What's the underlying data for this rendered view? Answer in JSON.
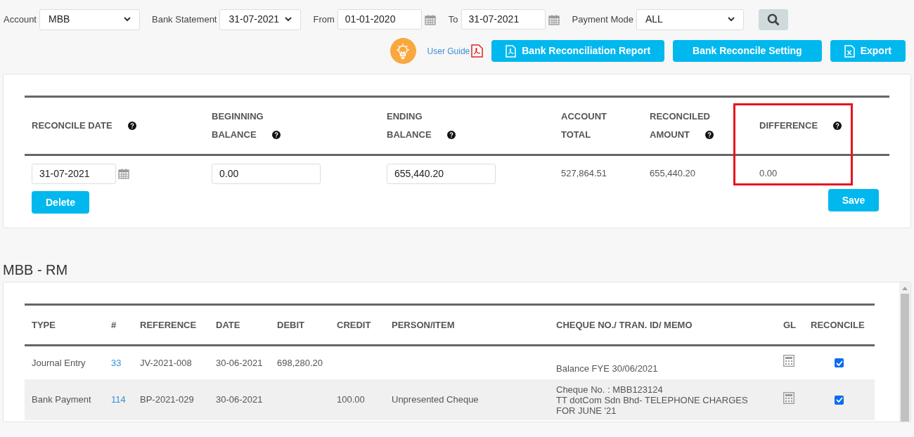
{
  "filters": [
    {
      "kind": "select",
      "label": "Account",
      "value": "MBB"
    },
    {
      "kind": "select",
      "label": "Bank Statement",
      "value": "31-07-2021"
    },
    {
      "kind": "date",
      "label": "From",
      "value": "01-01-2020"
    },
    {
      "kind": "date",
      "label": "To",
      "value": "31-07-2021"
    },
    {
      "kind": "select",
      "label": "Payment Mode",
      "value": "ALL"
    }
  ],
  "user_guide": "User Guide",
  "actions": [
    {
      "kind": "pdf",
      "label": "Bank Reconciliation Report"
    },
    {
      "kind": "plain",
      "label": "Bank Reconcile Setting"
    },
    {
      "kind": "excel",
      "label": "Export"
    }
  ],
  "summary": {
    "columns": [
      {
        "lines": [
          "RECONCILE DATE"
        ],
        "help": true,
        "highlighted": false
      },
      {
        "lines": [
          "BEGINNING",
          "BALANCE"
        ],
        "help": true,
        "highlighted": false
      },
      {
        "lines": [
          "ENDING",
          "BALANCE"
        ],
        "help": true,
        "highlighted": false
      },
      {
        "lines": [
          "ACCOUNT",
          "TOTAL"
        ],
        "help": false,
        "highlighted": false
      },
      {
        "lines": [
          "RECONCILED",
          "AMOUNT"
        ],
        "help": true,
        "highlighted": false
      },
      {
        "lines": [
          "DIFFERENCE"
        ],
        "help": true,
        "highlighted": true
      }
    ],
    "values": [
      {
        "kind": "date",
        "value": "31-07-2021"
      },
      {
        "kind": "input",
        "value": "0.00"
      },
      {
        "kind": "input",
        "value": "655,440.20"
      },
      {
        "kind": "text",
        "value": "527,864.51"
      },
      {
        "kind": "text",
        "value": "655,440.20"
      },
      {
        "kind": "text",
        "value": "0.00"
      }
    ],
    "delete_button": "Delete",
    "save_button": "Save"
  },
  "section_title": "MBB - RM",
  "table": {
    "columns": [
      "TYPE",
      "#",
      "REFERENCE",
      "DATE",
      "DEBIT",
      "CREDIT",
      "PERSON/ITEM",
      "CHEQUE NO./ TRAN. ID/ MEMO",
      "GL",
      "RECONCILE"
    ],
    "rows": [
      {
        "type": "Journal Entry",
        "number": "33",
        "reference": "JV-2021-008",
        "date": "30-06-2021",
        "debit": "698,280.20",
        "person": "",
        "memo": [
          "Balance FYE 30/06/2021"
        ],
        "reconciled": true
      },
      {
        "type": "Bank Payment",
        "number": "114",
        "reference": "BP-2021-029",
        "date": "30-06-2021",
        "credit": "100.00",
        "person": "Unpresented Cheque",
        "memo": [
          "Cheque No. : MBB123124",
          "TT dotCom Sdn Bhd- TELEPHONE CHARGES FOR JUNE '21"
        ],
        "reconciled": true
      }
    ]
  }
}
